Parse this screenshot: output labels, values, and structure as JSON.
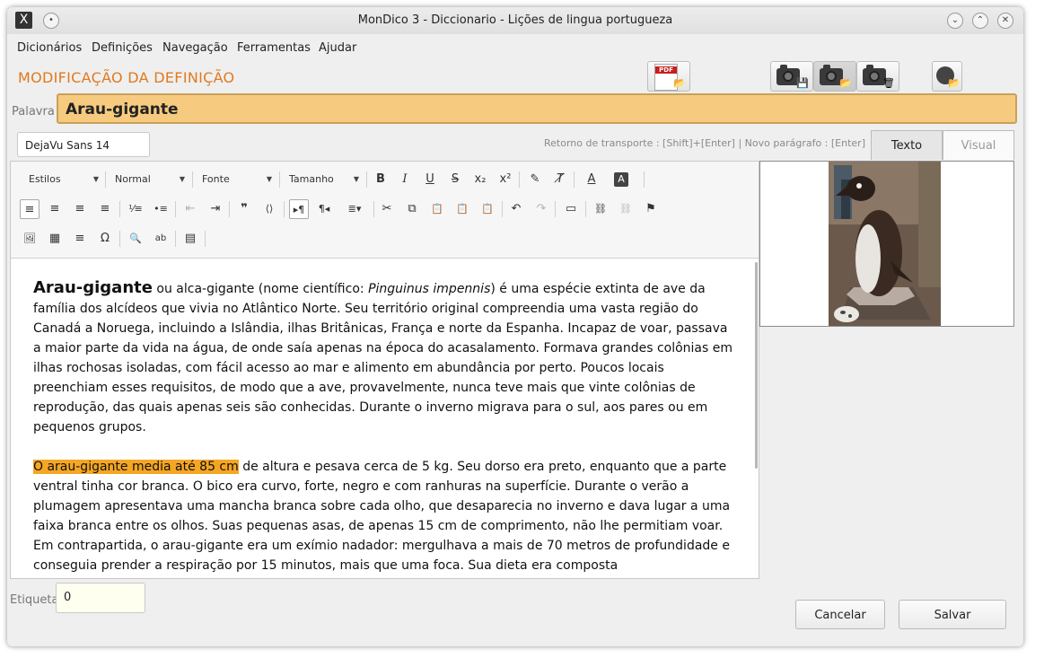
{
  "window": {
    "title": "MonDico 3 - Diccionario - Lições de lingua portugueza",
    "logo": "X"
  },
  "menu": [
    "Dicionários",
    "Definições",
    "Navegação",
    "Ferramentas",
    "Ajudar"
  ],
  "header": {
    "title": "MODIFICAÇÃO DA DEFINIÇÃO",
    "pdf_text": "PDF"
  },
  "word": {
    "label": "Palavra",
    "value": "Arau-gigante"
  },
  "font_selector": "DejaVu Sans 14",
  "hint": "Retorno de transporte : [Shift]+[Enter] | Novo parágrafo : [Enter]",
  "tabs": [
    {
      "label": "Texto",
      "active": true
    },
    {
      "label": "Visual",
      "active": false
    }
  ],
  "toolbar": {
    "combos": [
      "Estilos",
      "Normal",
      "Fonte",
      "Tamanho"
    ],
    "glyphs": {
      "bold": "B",
      "italic": "I",
      "underline": "U",
      "strike": "S",
      "sub": "x₂",
      "sup": "x²",
      "brush": "✎",
      "clear": "T̸",
      "color": "A",
      "bgcolor": "A",
      "align_left": "≡",
      "align_center": "≡",
      "align_right": "≡",
      "justify": "≡",
      "ol": "⅟≡",
      "ul": "•≡",
      "outdent": "⇤",
      "indent": "⇥",
      "quote": "❞",
      "code": "⟨⟩",
      "ltr": "▸¶",
      "rtl": "¶◂",
      "format": "≣▾",
      "cut": "✂",
      "copy": "⧉",
      "paste": "📋",
      "paste_text": "📋",
      "paste_word": "📋",
      "undo": "↶",
      "redo": "↷",
      "field": "▭",
      "link": "⛓",
      "unlink": "⛓",
      "flag": "⚑",
      "image": "🖼",
      "table": "▦",
      "hr": "≡",
      "omega": "Ω",
      "find": "🔍",
      "replace": "ab",
      "source": "▤"
    }
  },
  "content": {
    "p1_headword": "Arau-gigante",
    "p1_a": " ou alca-gigante (nome científico: ",
    "p1_latin": "Pinguinus impennis",
    "p1_b": ") é uma espécie extinta de ave da família dos alcídeos que vivia no Atlântico Norte. Seu território original compreendia uma vasta região do Canadá a Noruega, incluindo a Islândia, ilhas Britânicas, França e norte da Espanha. Incapaz de voar, passava a maior parte da vida na água, de onde saía apenas na época do acasalamento. Formava grandes colônias em ilhas rochosas isoladas, com fácil acesso ao mar e alimento em abundância por perto. Poucos locais preenchiam esses requisitos, de modo que a ave, provavelmente, nunca teve mais que vinte colônias de reprodução, das quais apenas seis são conhecidas. Durante o inverno migrava para o sul, aos pares ou em pequenos grupos.",
    "p2_highlight": "O arau-gigante media até 85 cm",
    "p2_rest": " de altura e pesava cerca de 5 kg. Seu dorso era preto, enquanto que a parte ventral tinha cor branca. O bico era curvo, forte, negro e com ranhuras na superfície. Durante o verão a plumagem apresentava uma mancha branca sobre cada olho, que desaparecia no inverno e dava lugar a uma faixa branca entre os olhos. Suas pequenas asas, de apenas 15 cm de comprimento, não lhe permitiam voar. Em contrapartida, o arau-gigante era um exímio nadador: mergulhava a mais de 70 metros de profundidade e conseguia prender a respiração por 15 minutos, mais que uma foca. Sua dieta era composta"
  },
  "etiqueta": {
    "label": "Etiqueta",
    "value": "0"
  },
  "buttons": {
    "cancel": "Cancelar",
    "save": "Salvar"
  },
  "colors": {
    "accent": "#e07a1f",
    "word_bg": "#f7cb7f",
    "highlight": "#f5a623"
  }
}
